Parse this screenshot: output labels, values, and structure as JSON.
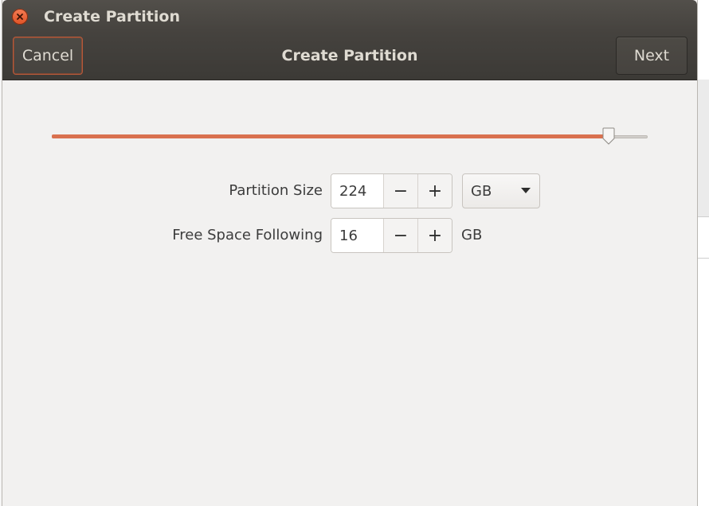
{
  "window": {
    "title": "Create Partition"
  },
  "headerbar": {
    "title": "Create Partition",
    "cancel_label": "Cancel",
    "next_label": "Next"
  },
  "slider": {
    "fraction": 0.934,
    "fill_color": "#d9714f"
  },
  "fields": {
    "partition_size": {
      "label": "Partition Size",
      "value": "224",
      "minus": "−",
      "plus": "+",
      "unit": "GB"
    },
    "free_space_following": {
      "label": "Free Space Following",
      "value": "16",
      "minus": "−",
      "plus": "+",
      "unit": "GB"
    }
  },
  "icons": {
    "close": "close-icon",
    "dropdown": "chevron-down-icon"
  },
  "colors": {
    "titlebar": "#45423e",
    "accent": "#e95420",
    "background": "#f2f1f0"
  }
}
